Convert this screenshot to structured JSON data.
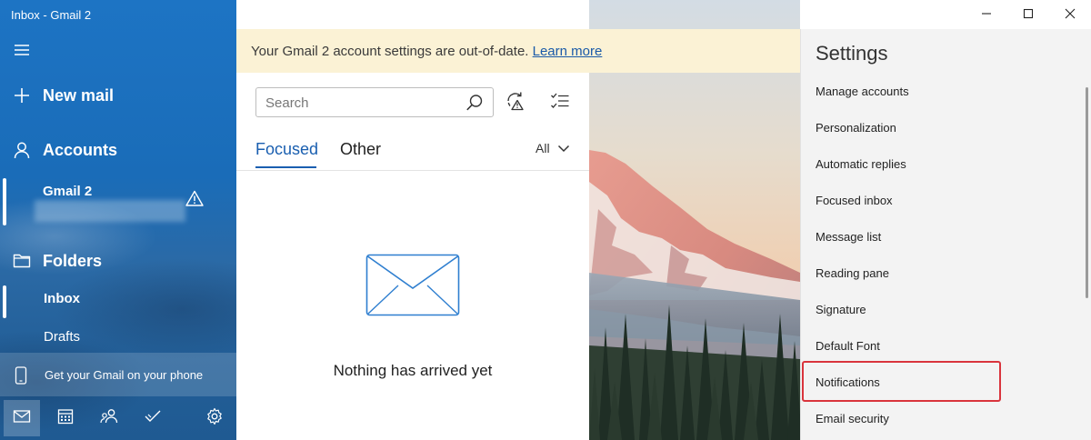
{
  "window": {
    "title": "Inbox - Gmail 2"
  },
  "sidebar": {
    "new_mail": "New mail",
    "accounts_label": "Accounts",
    "account": {
      "name": "Gmail 2",
      "status": "warning"
    },
    "folders_label": "Folders",
    "folders": [
      {
        "label": "Inbox",
        "selected": true
      },
      {
        "label": "Drafts",
        "selected": false
      }
    ],
    "phone_promo": "Get your Gmail on your phone",
    "bottom_nav": [
      "mail-icon",
      "calendar-icon",
      "people-icon",
      "todo-icon",
      "settings-gear-icon"
    ],
    "accent": "#1d74c4"
  },
  "banner": {
    "message": "Your Gmail 2 account settings are out-of-date.",
    "link": "Learn more",
    "bg_color": "#fbf2d5"
  },
  "search": {
    "placeholder": "Search",
    "value": ""
  },
  "tabs": {
    "focused": "Focused",
    "other": "Other",
    "active": "Focused"
  },
  "filter": {
    "label": "All"
  },
  "empty_state": {
    "message": "Nothing has arrived yet"
  },
  "settings": {
    "title": "Settings",
    "items": [
      "Manage accounts",
      "Personalization",
      "Automatic replies",
      "Focused inbox",
      "Message list",
      "Reading pane",
      "Signature",
      "Default Font",
      "Notifications",
      "Email security"
    ],
    "highlighted": "Notifications",
    "highlight_color": "#d9343c"
  }
}
